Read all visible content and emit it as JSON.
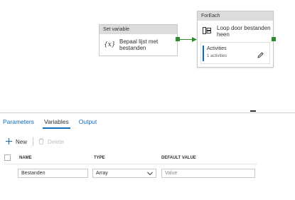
{
  "canvas": {
    "set_variable": {
      "type_label": "Set variable",
      "icon_glyph": "{x}",
      "name": "Bepaal lijst met bestanden"
    },
    "foreach": {
      "type_label": "ForEach",
      "name": "Loop door bestanden heen",
      "activities_label": "Activities",
      "activities_count": "1 activities"
    },
    "colors": {
      "connector": "#2e8b2e",
      "accent": "#0f6cbd"
    }
  },
  "panel": {
    "tabs": [
      {
        "label": "Parameters",
        "active": false
      },
      {
        "label": "Variables",
        "active": true
      },
      {
        "label": "Output",
        "active": false
      }
    ],
    "toolbar": {
      "new_label": "New",
      "delete_label": "Delete"
    },
    "table": {
      "headers": {
        "name": "NAME",
        "type": "TYPE",
        "default": "DEFAULT VALUE"
      },
      "rows": [
        {
          "name": "Bestanden",
          "type": "Array",
          "default_placeholder": "Value"
        }
      ]
    }
  }
}
